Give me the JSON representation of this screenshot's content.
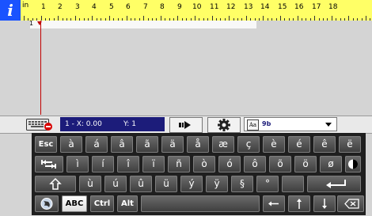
{
  "app": {
    "info_icon": "i",
    "ruler": {
      "unit_label": "in",
      "numbers": [
        "1",
        "2",
        "3",
        "4",
        "5",
        "6",
        "7",
        "8",
        "9",
        "10",
        "11",
        "12",
        "13",
        "14",
        "15",
        "16",
        "17",
        "18"
      ]
    },
    "document": {
      "line_number": "1"
    },
    "toolbar": {
      "keyboard_icon": "keyboard-toggle-icon",
      "status_x": "1 - X: 0.00",
      "status_y": "Y: 1",
      "goto_icon": "arrow-right-icon",
      "settings_icon": "gear-icon",
      "font_icon": "Aa",
      "font_name": "9b"
    },
    "keyboard": {
      "row1": [
        "Esc",
        "à",
        "á",
        "â",
        "ã",
        "ä",
        "å",
        "æ",
        "ç",
        "è",
        "é",
        "ê",
        "ë"
      ],
      "row2": [
        "ì",
        "í",
        "î",
        "ï",
        "ñ",
        "ò",
        "ó",
        "ô",
        "õ",
        "ö",
        "ø"
      ],
      "row3": [
        "ù",
        "ú",
        "û",
        "ü",
        "ý",
        "ÿ",
        "§",
        "°"
      ],
      "row4": [
        "ABC",
        "Ctrl",
        "Alt"
      ]
    }
  }
}
